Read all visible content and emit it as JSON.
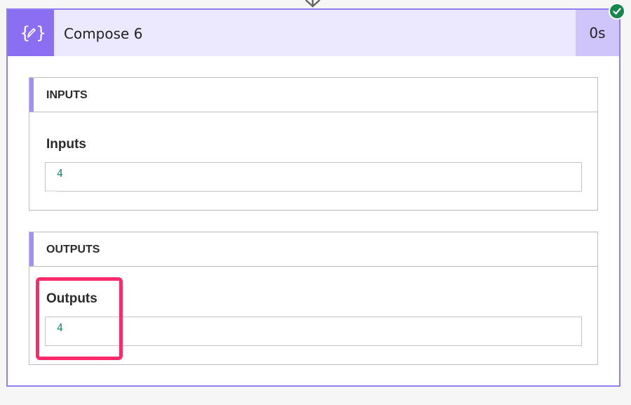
{
  "action": {
    "title": "Compose 6",
    "duration": "0s",
    "status": "succeeded",
    "icon": "compose-braces-icon",
    "colors": {
      "accent": "#8a6ff2",
      "header_bg": "#ece8fd",
      "duration_bg": "#cfc5fb",
      "success": "#17874a",
      "highlight": "#fb2b6b",
      "value_text": "#1a8a6a"
    }
  },
  "inputs_section": {
    "heading": "INPUTS",
    "field_label": "Inputs",
    "value": "4"
  },
  "outputs_section": {
    "heading": "OUTPUTS",
    "field_label": "Outputs",
    "value": "4",
    "highlighted": true
  }
}
